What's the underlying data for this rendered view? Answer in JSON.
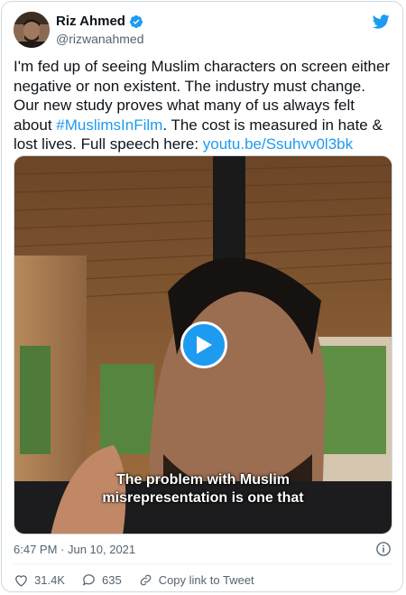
{
  "author": {
    "display_name": "Riz Ahmed",
    "handle": "@rizwanahmed"
  },
  "tweet": {
    "text_part1": "I'm fed up of seeing Muslim characters on screen either negative or non existent. The industry must change. Our new study proves what many of us always felt about ",
    "hashtag": "#MuslimsInFilm",
    "text_part2": ". The cost is measured in hate & lost lives. Full speech here: ",
    "link": "youtu.be/Ssuhvv0l3bk"
  },
  "video": {
    "subtitle_line1": "The problem with Muslim",
    "subtitle_line2": "misrepresentation is one that"
  },
  "meta": {
    "timestamp": "6:47 PM · Jun 10, 2021"
  },
  "actions": {
    "likes": "31.4K",
    "replies": "635",
    "copy_link": "Copy link to Tweet"
  },
  "colors": {
    "accent": "#1d9bf0",
    "like": "#f91880",
    "text": "#0f1419",
    "muted": "#536471"
  },
  "icons": [
    "verified-icon",
    "twitter-bird-icon",
    "play-icon",
    "info-icon",
    "heart-icon",
    "reply-icon",
    "link-icon"
  ]
}
